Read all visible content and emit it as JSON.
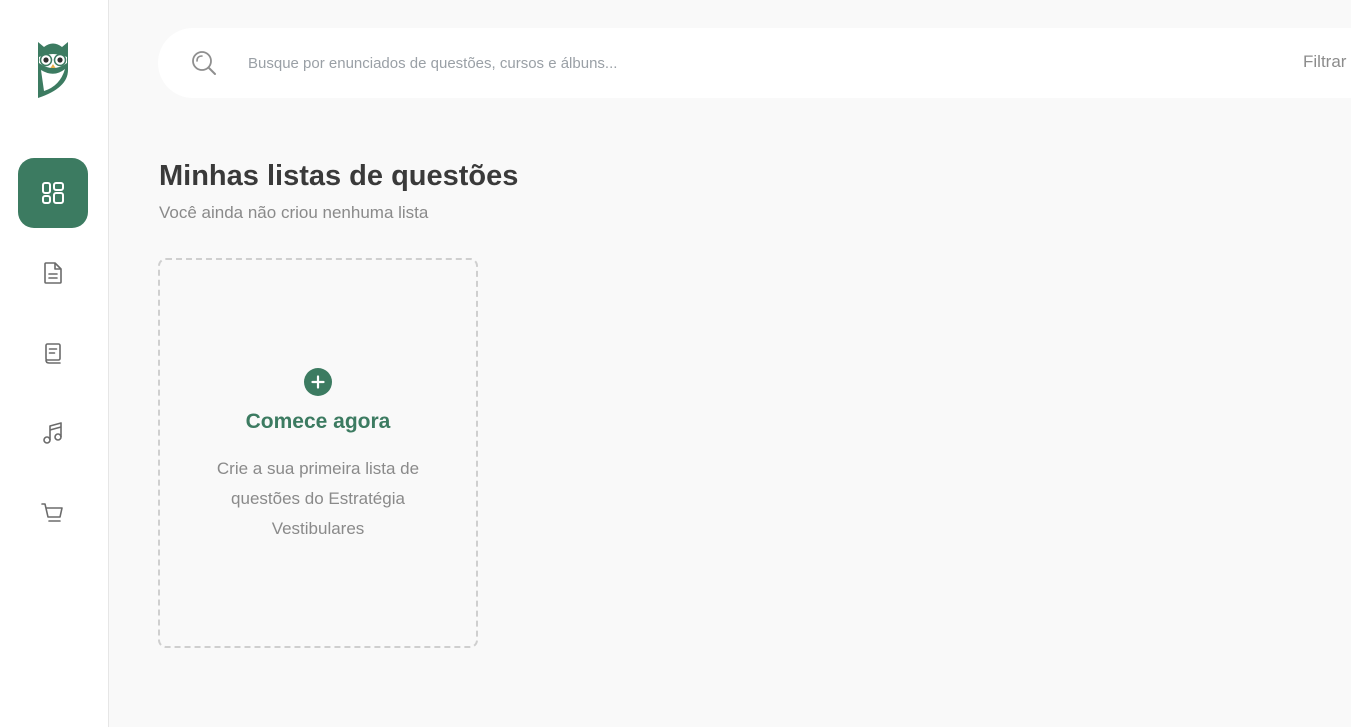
{
  "search": {
    "placeholder": "Busque por enunciados de questões, cursos e álbuns...",
    "value": "",
    "filter_label": "Filtrar por:"
  },
  "sidebar": {
    "items": [
      {
        "name": "dashboard",
        "icon": "grid-icon",
        "active": true
      },
      {
        "name": "questions",
        "icon": "document-icon",
        "active": false
      },
      {
        "name": "courses",
        "icon": "book-icon",
        "active": false
      },
      {
        "name": "albums",
        "icon": "music-note-icon",
        "active": false
      },
      {
        "name": "shop",
        "icon": "cart-icon",
        "active": false
      }
    ]
  },
  "main": {
    "title": "Minhas listas de questões",
    "subtitle": "Você ainda não criou nenhuma lista",
    "create_card": {
      "title": "Comece agora",
      "description": "Crie a sua primeira lista de questões do Estratégia Vestibulares"
    }
  },
  "colors": {
    "brand": "#3c7b61",
    "background": "#f9f9f9",
    "title_text": "#3a3a3a",
    "muted_text": "#8a8a8a"
  }
}
